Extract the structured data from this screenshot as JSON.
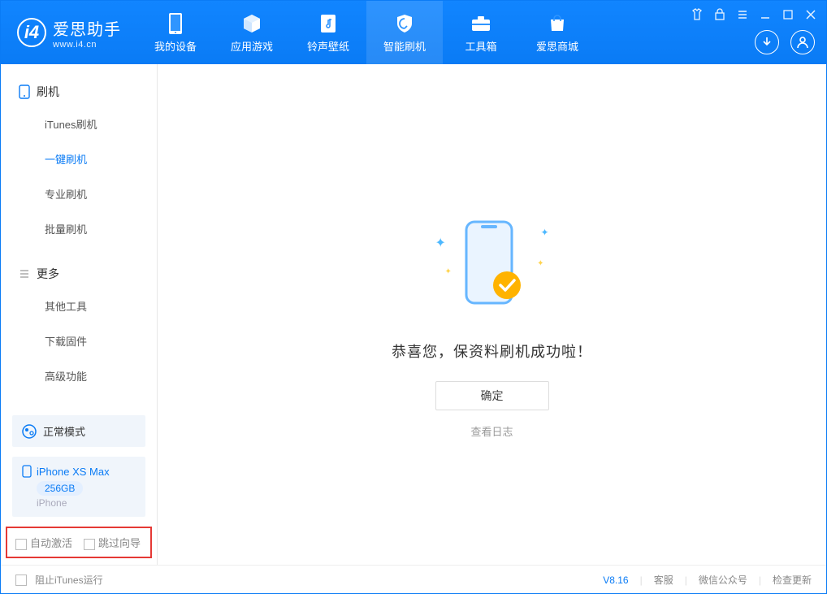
{
  "app": {
    "name": "爱思助手",
    "url": "www.i4.cn"
  },
  "nav": {
    "device": "我的设备",
    "apps": "应用游戏",
    "ring": "铃声壁纸",
    "flash": "智能刷机",
    "toolbox": "工具箱",
    "store": "爱思商城"
  },
  "sidebar": {
    "flash_header": "刷机",
    "items": {
      "itunes": "iTunes刷机",
      "onekey": "一键刷机",
      "pro": "专业刷机",
      "batch": "批量刷机"
    },
    "more_header": "更多",
    "more_items": {
      "other": "其他工具",
      "firmware": "下载固件",
      "advanced": "高级功能"
    },
    "mode": "正常模式",
    "device": {
      "name": "iPhone XS Max",
      "storage": "256GB",
      "type": "iPhone"
    },
    "callout": {
      "auto_activate": "自动激活",
      "skip_guide": "跳过向导"
    }
  },
  "main": {
    "success": "恭喜您，保资料刷机成功啦！",
    "ok": "确定",
    "view_log": "查看日志"
  },
  "footer": {
    "block_itunes": "阻止iTunes运行",
    "version": "V8.16",
    "support": "客服",
    "wechat": "微信公众号",
    "update": "检查更新"
  }
}
